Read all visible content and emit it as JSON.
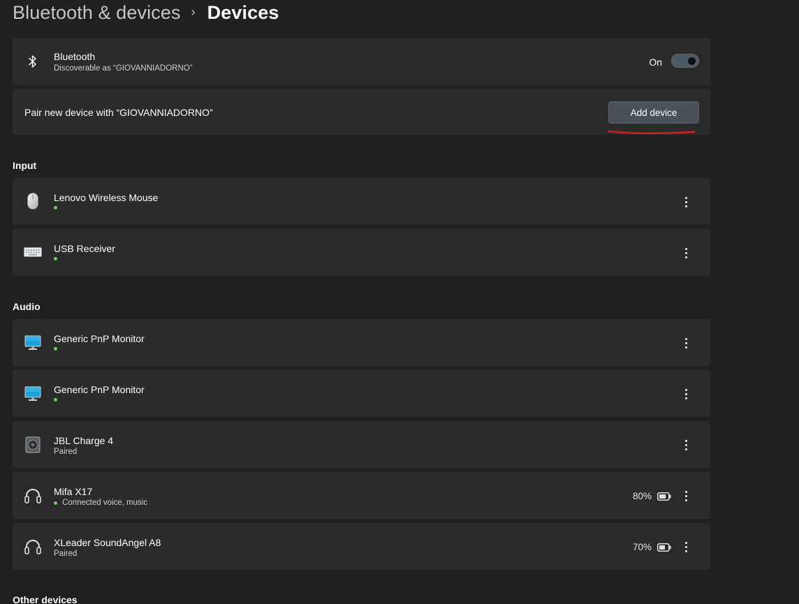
{
  "breadcrumb": {
    "parent": "Bluetooth & devices",
    "separator": "›",
    "current": "Devices"
  },
  "bluetooth": {
    "icon": "bluetooth-icon",
    "title": "Bluetooth",
    "subtitle": "Discoverable as “GIOVANNIADORNO”",
    "toggle_label": "On",
    "toggle_on": true
  },
  "pair": {
    "label": "Pair new device with “GIOVANNIADORNO”",
    "button_label": "Add device",
    "annotation_color": "#d41f1f"
  },
  "input": {
    "label": "Input",
    "devices": [
      {
        "name": "Lenovo Wireless Mouse",
        "icon": "mouse-icon",
        "status_dot": true,
        "status": ""
      },
      {
        "name": "USB Receiver",
        "icon": "keyboard-icon",
        "status_dot": true,
        "status": ""
      }
    ]
  },
  "audio": {
    "label": "Audio",
    "devices": [
      {
        "name": "Generic PnP Monitor",
        "icon": "monitor-icon",
        "status_dot": true,
        "status": ""
      },
      {
        "name": "Generic PnP Monitor",
        "icon": "monitor-icon",
        "status_dot": true,
        "status": ""
      },
      {
        "name": "JBL Charge 4",
        "icon": "speaker-icon",
        "status_dot": false,
        "status": "Paired"
      },
      {
        "name": "Mifa X17",
        "icon": "headset-icon",
        "status_dot": true,
        "status": "Connected voice, music",
        "battery": "80%",
        "battery_level": 0.8
      },
      {
        "name": "XLeader SoundAngel A8",
        "icon": "headset-icon",
        "status_dot": false,
        "status": "Paired",
        "battery": "70%",
        "battery_level": 0.7
      }
    ]
  },
  "other": {
    "label": "Other devices"
  },
  "colors": {
    "background": "#202020",
    "card": "#2b2b2b",
    "status_green": "#6ccb5f",
    "button": "#4a5259"
  }
}
